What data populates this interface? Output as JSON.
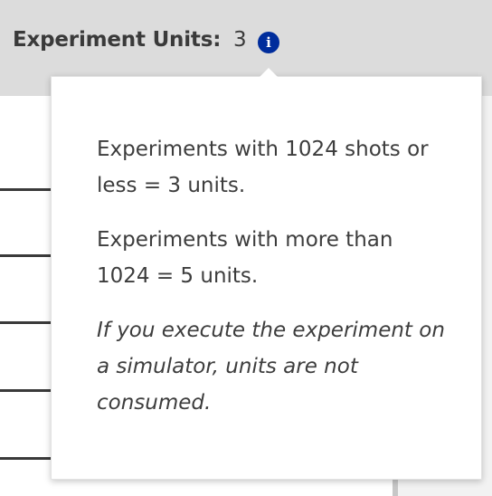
{
  "header": {
    "units_label": "Experiment Units:",
    "units_value": "3",
    "info_icon_glyph": "i"
  },
  "popover": {
    "line1": "Experiments with 1024 shots or less = 3 units.",
    "line2": "Experiments with more than 1024 = 5 units.",
    "note": "If you execute the experiment on a simulator, units are not consumed."
  },
  "colors": {
    "info_icon": "#002d9c",
    "header_bg": "#dcdcdc",
    "text": "#3d3d3d"
  },
  "icons": {
    "info": "info-icon"
  }
}
